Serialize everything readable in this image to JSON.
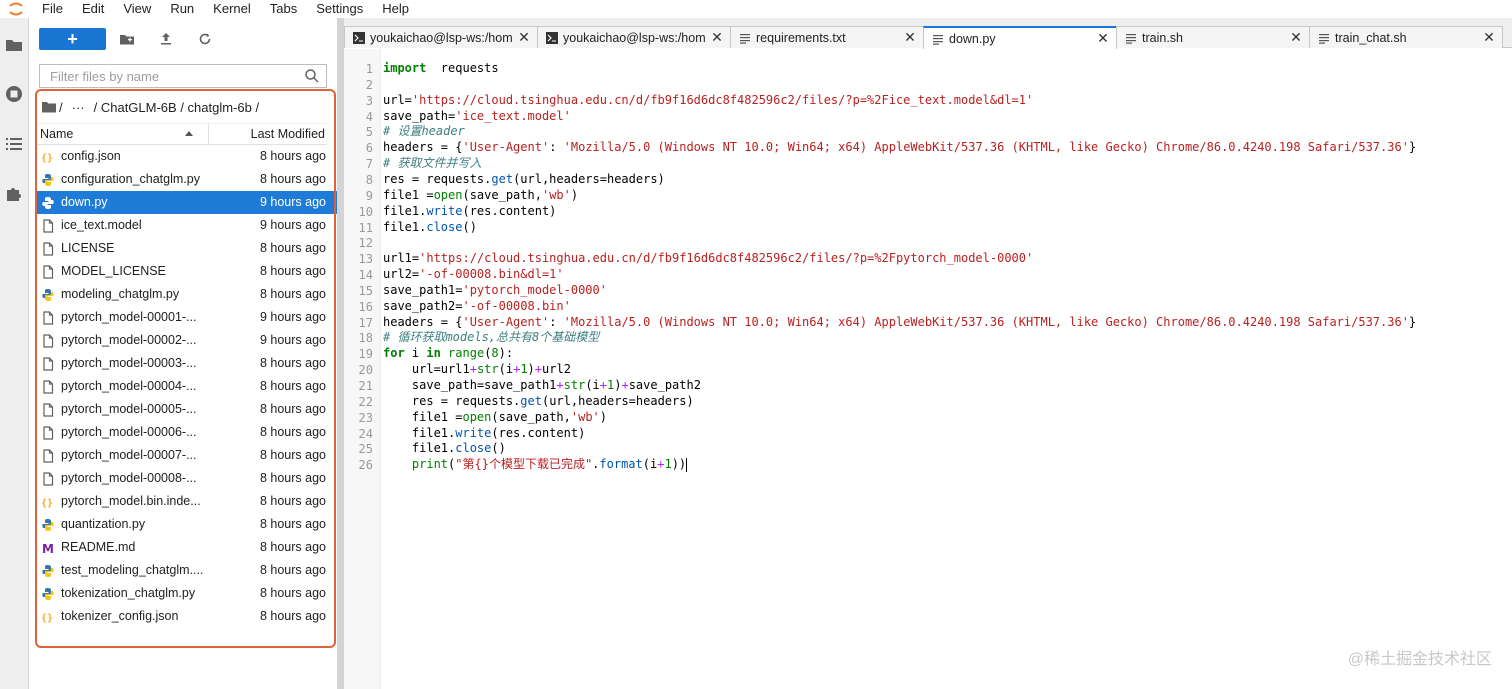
{
  "menubar": {
    "items": [
      "File",
      "Edit",
      "View",
      "Run",
      "Kernel",
      "Tabs",
      "Settings",
      "Help"
    ]
  },
  "sidebar": {
    "icons": [
      "folder-icon",
      "running-icon",
      "toc-icon",
      "extension-icon"
    ]
  },
  "filebrowser": {
    "new_label": "+",
    "filter_placeholder": "Filter files by name",
    "breadcrumb": {
      "root": "/",
      "ellipsis": "···",
      "path": "/ ChatGLM-6B / chatglm-6b /"
    },
    "columns": {
      "name": "Name",
      "modified": "Last Modified"
    },
    "files": [
      {
        "name": "config.json",
        "modified": "8 hours ago",
        "type": "json"
      },
      {
        "name": "configuration_chatglm.py",
        "modified": "8 hours ago",
        "type": "python"
      },
      {
        "name": "down.py",
        "modified": "9 hours ago",
        "type": "python",
        "selected": true
      },
      {
        "name": "ice_text.model",
        "modified": "9 hours ago",
        "type": "file"
      },
      {
        "name": "LICENSE",
        "modified": "8 hours ago",
        "type": "file"
      },
      {
        "name": "MODEL_LICENSE",
        "modified": "8 hours ago",
        "type": "file"
      },
      {
        "name": "modeling_chatglm.py",
        "modified": "8 hours ago",
        "type": "python"
      },
      {
        "name": "pytorch_model-00001-...",
        "modified": "9 hours ago",
        "type": "file"
      },
      {
        "name": "pytorch_model-00002-...",
        "modified": "9 hours ago",
        "type": "file"
      },
      {
        "name": "pytorch_model-00003-...",
        "modified": "8 hours ago",
        "type": "file"
      },
      {
        "name": "pytorch_model-00004-...",
        "modified": "8 hours ago",
        "type": "file"
      },
      {
        "name": "pytorch_model-00005-...",
        "modified": "8 hours ago",
        "type": "file"
      },
      {
        "name": "pytorch_model-00006-...",
        "modified": "8 hours ago",
        "type": "file"
      },
      {
        "name": "pytorch_model-00007-...",
        "modified": "8 hours ago",
        "type": "file"
      },
      {
        "name": "pytorch_model-00008-...",
        "modified": "8 hours ago",
        "type": "file"
      },
      {
        "name": "pytorch_model.bin.inde...",
        "modified": "8 hours ago",
        "type": "json"
      },
      {
        "name": "quantization.py",
        "modified": "8 hours ago",
        "type": "python"
      },
      {
        "name": "README.md",
        "modified": "8 hours ago",
        "type": "markdown"
      },
      {
        "name": "test_modeling_chatglm....",
        "modified": "8 hours ago",
        "type": "python"
      },
      {
        "name": "tokenization_chatglm.py",
        "modified": "8 hours ago",
        "type": "python"
      },
      {
        "name": "tokenizer_config.json",
        "modified": "8 hours ago",
        "type": "json"
      }
    ]
  },
  "tabs": [
    {
      "label": "youkaichao@lsp-ws:/hom",
      "type": "terminal"
    },
    {
      "label": "youkaichao@lsp-ws:/hom",
      "type": "terminal"
    },
    {
      "label": "requirements.txt",
      "type": "text"
    },
    {
      "label": "down.py",
      "type": "text",
      "active": true
    },
    {
      "label": "train.sh",
      "type": "text"
    },
    {
      "label": "train_chat.sh",
      "type": "text"
    }
  ],
  "editor": {
    "lines": [
      [
        [
          "kw",
          "import"
        ],
        [
          "",
          "  requests"
        ]
      ],
      [],
      [
        [
          "",
          "url="
        ],
        [
          "str",
          "'https://cloud.tsinghua.edu.cn/d/fb9f16d6dc8f482596c2/files/?p=%2Fice_text.model&dl=1'"
        ]
      ],
      [
        [
          "",
          "save_path="
        ],
        [
          "str",
          "'ice_text.model'"
        ]
      ],
      [
        [
          "com",
          "# 设置header"
        ]
      ],
      [
        [
          "",
          "headers = {"
        ],
        [
          "str",
          "'User-Agent'"
        ],
        [
          "",
          ": "
        ],
        [
          "str",
          "'Mozilla/5.0 (Windows NT 10.0; Win64; x64) AppleWebKit/537.36 (KHTML, like Gecko) Chrome/86.0.4240.198 Safari/537.36'"
        ],
        [
          "",
          "}"
        ]
      ],
      [
        [
          "com",
          "# 获取文件并写入"
        ]
      ],
      [
        [
          "",
          "res = requests."
        ],
        [
          "mth",
          "get"
        ],
        [
          "",
          "(url,headers=headers)"
        ]
      ],
      [
        [
          "",
          "file1 ="
        ],
        [
          "bi",
          "open"
        ],
        [
          "",
          "(save_path,"
        ],
        [
          "str",
          "'wb'"
        ],
        [
          "",
          ")"
        ]
      ],
      [
        [
          "",
          "file1."
        ],
        [
          "mth",
          "write"
        ],
        [
          "",
          "(res.content)"
        ]
      ],
      [
        [
          "",
          "file1."
        ],
        [
          "mth",
          "close"
        ],
        [
          "",
          "()"
        ]
      ],
      [],
      [
        [
          "",
          "url1="
        ],
        [
          "str",
          "'https://cloud.tsinghua.edu.cn/d/fb9f16d6dc8f482596c2/files/?p=%2Fpytorch_model-0000'"
        ]
      ],
      [
        [
          "",
          "url2="
        ],
        [
          "str",
          "'-of-00008.bin&dl=1'"
        ]
      ],
      [
        [
          "",
          "save_path1="
        ],
        [
          "str",
          "'pytorch_model-0000'"
        ]
      ],
      [
        [
          "",
          "save_path2="
        ],
        [
          "str",
          "'-of-00008.bin'"
        ]
      ],
      [
        [
          "",
          "headers = {"
        ],
        [
          "str",
          "'User-Agent'"
        ],
        [
          "",
          ": "
        ],
        [
          "str",
          "'Mozilla/5.0 (Windows NT 10.0; Win64; x64) AppleWebKit/537.36 (KHTML, like Gecko) Chrome/86.0.4240.198 Safari/537.36'"
        ],
        [
          "",
          "}"
        ]
      ],
      [
        [
          "com",
          "# 循环获取models,总共有8个基础模型"
        ]
      ],
      [
        [
          "kw",
          "for"
        ],
        [
          "",
          " i "
        ],
        [
          "kw",
          "in"
        ],
        [
          "",
          ""
        ],
        [
          "bi",
          " range"
        ],
        [
          "",
          "("
        ],
        [
          "num",
          "8"
        ],
        [
          "",
          "):"
        ]
      ],
      [
        [
          "",
          "    url=url1"
        ],
        [
          "op",
          "+"
        ],
        [
          "bi",
          "str"
        ],
        [
          "",
          "(i"
        ],
        [
          "op",
          "+"
        ],
        [
          "num",
          "1"
        ],
        [
          "",
          ")"
        ],
        [
          "op",
          "+"
        ],
        [
          "",
          "url2"
        ]
      ],
      [
        [
          "",
          "    save_path=save_path1"
        ],
        [
          "op",
          "+"
        ],
        [
          "bi",
          "str"
        ],
        [
          "",
          "(i"
        ],
        [
          "op",
          "+"
        ],
        [
          "num",
          "1"
        ],
        [
          "",
          ")"
        ],
        [
          "op",
          "+"
        ],
        [
          "",
          "save_path2"
        ]
      ],
      [
        [
          "",
          "    res = requests."
        ],
        [
          "mth",
          "get"
        ],
        [
          "",
          "(url,headers=headers)"
        ]
      ],
      [
        [
          "",
          "    file1 ="
        ],
        [
          "bi",
          "open"
        ],
        [
          "",
          "(save_path,"
        ],
        [
          "str",
          "'wb'"
        ],
        [
          "",
          ")"
        ]
      ],
      [
        [
          "",
          "    file1."
        ],
        [
          "mth",
          "write"
        ],
        [
          "",
          "(res.content)"
        ]
      ],
      [
        [
          "",
          "    file1."
        ],
        [
          "mth",
          "close"
        ],
        [
          "",
          "()"
        ]
      ],
      [
        [
          "",
          "    "
        ],
        [
          "bi",
          "print"
        ],
        [
          "",
          "("
        ],
        [
          "str",
          "\"第{}个模型下载已完成\""
        ],
        [
          "",
          "."
        ],
        [
          "mth",
          "format"
        ],
        [
          "",
          "(i"
        ],
        [
          "op",
          "+"
        ],
        [
          "num",
          "1"
        ],
        [
          "",
          "))"
        ]
      ]
    ]
  },
  "watermark": "@稀土掘金技术社区"
}
